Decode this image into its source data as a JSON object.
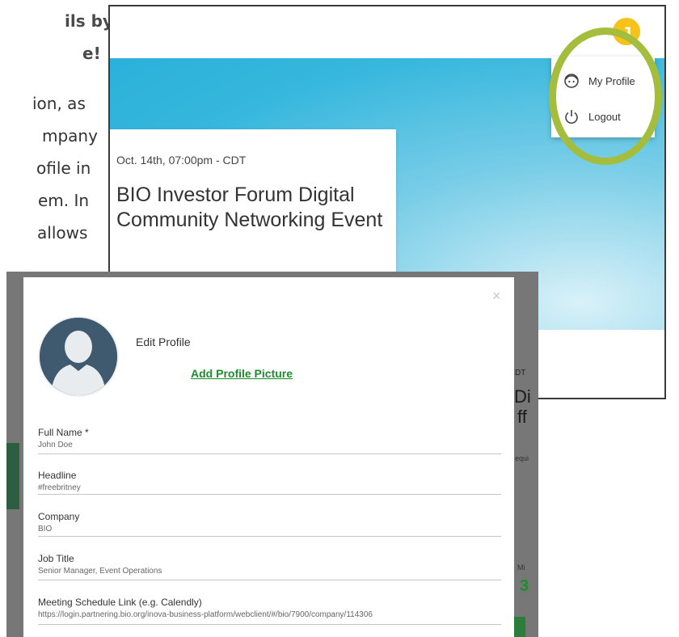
{
  "document": {
    "heading_lines": [
      "ils by",
      "e!"
    ],
    "body_lines": [
      "ion, as",
      "mpany",
      "ofile in",
      "em. In",
      "allows"
    ]
  },
  "profile_menu": {
    "avatar_initial": "J",
    "items": [
      {
        "label": "My Profile",
        "icon": "face-icon"
      },
      {
        "label": "Logout",
        "icon": "power-icon"
      }
    ]
  },
  "event": {
    "date": "Oct. 14th, 07:00pm - CDT",
    "title": "BIO Investor Forum Digital Community Networking Event"
  },
  "background_peek": {
    "date_suffix": "DT",
    "title_fragment_1": "Di",
    "title_fragment_2": "ff",
    "small_text": "equi",
    "min_label": "Mi",
    "number": "3"
  },
  "edit_profile": {
    "title": "Edit Profile",
    "close_label": "×",
    "add_picture_label": "Add Profile Picture",
    "fields": [
      {
        "label": "Full Name *",
        "value": "John Doe"
      },
      {
        "label": "Headline",
        "value": "#freebritney"
      },
      {
        "label": "Company",
        "value": "BIO"
      },
      {
        "label": "Job Title",
        "value": "Senior Manager, Event Operations"
      },
      {
        "label": "Meeting Schedule Link (e.g. Calendly)",
        "value": "https://login.partnering.bio.org/inova-business-platform/webclient/#/bio/7900/company/114306"
      }
    ]
  },
  "colors": {
    "accent_green": "#1e8c2a",
    "highlight_ring": "#a5bd3c",
    "avatar_yellow": "#f7c21a",
    "banner_blue": "#36b7dd"
  }
}
